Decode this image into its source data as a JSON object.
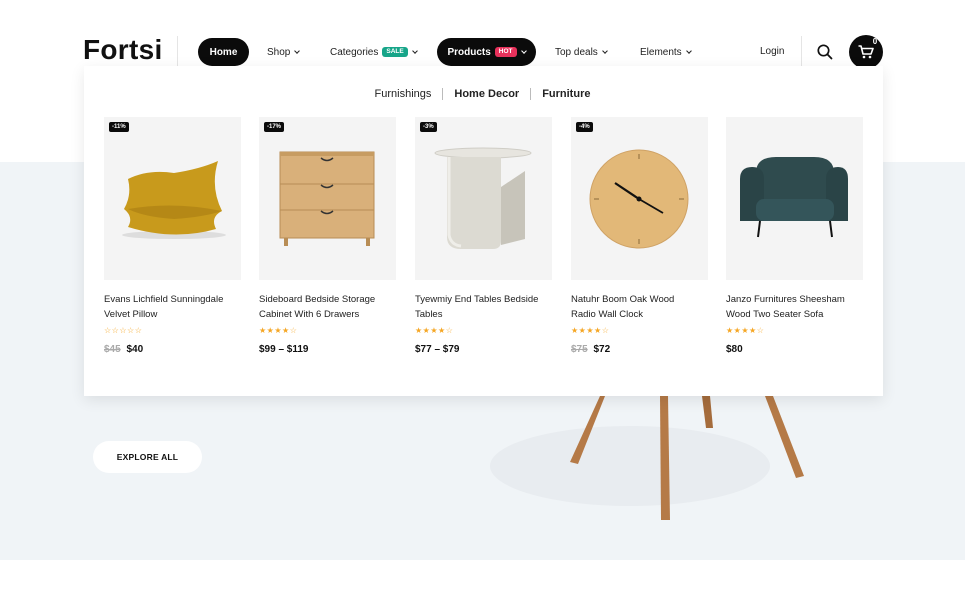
{
  "brand": {
    "logo_text": "Fortsi"
  },
  "nav": {
    "items": [
      {
        "label": "Home",
        "active": true
      },
      {
        "label": "Shop",
        "caret": true
      },
      {
        "label": "Categories",
        "badge": "SALE",
        "caret": true
      },
      {
        "label": "Products",
        "badge": "HOT",
        "caret": true,
        "active": true
      },
      {
        "label": "Top deals",
        "caret": true
      },
      {
        "label": "Elements",
        "caret": true
      }
    ],
    "login_label": "Login",
    "search_icon": "search-icon",
    "cart_icon": "cart-icon",
    "cart_count": "0"
  },
  "dropdown": {
    "tabs": [
      {
        "label": "Furnishings"
      },
      {
        "label": "Home Decor",
        "active": true
      },
      {
        "label": "Furniture"
      }
    ],
    "products": [
      {
        "discount": "-11%",
        "name_line1": "Evans Lichfield Sunningdale",
        "name_line2": "Velvet Pillow",
        "rating": 0,
        "old_price": "$45",
        "price": "$40"
      },
      {
        "discount": "-17%",
        "name_line1": "Sideboard Bedside Storage",
        "name_line2": "Cabinet With 6 Drawers",
        "rating": 4,
        "old_price": "",
        "price": "$99 – $119"
      },
      {
        "discount": "-3%",
        "name_line1": "Tyewmiy End Tables Bedside",
        "name_line2": "Tables",
        "rating": 4,
        "old_price": "",
        "price": "$77 – $79"
      },
      {
        "discount": "-4%",
        "name_line1": "Natuhr Boom Oak Wood",
        "name_line2": "Radio Wall Clock",
        "rating": 4,
        "old_price": "$75",
        "price": "$72"
      },
      {
        "discount": "",
        "name_line1": "Janzo Furnitures Sheesham",
        "name_line2": "Wood Two Seater Sofa",
        "rating": 4,
        "old_price": "",
        "price": "$80"
      }
    ]
  },
  "hero": {
    "cta_label": "EXPLORE ALL"
  },
  "colors": {
    "accent": "#0b0b0b",
    "sale_badge": "#17a589",
    "hot_badge": "#e8315b",
    "star": "#f5a623",
    "hero_bg": "#f0f4f7"
  }
}
